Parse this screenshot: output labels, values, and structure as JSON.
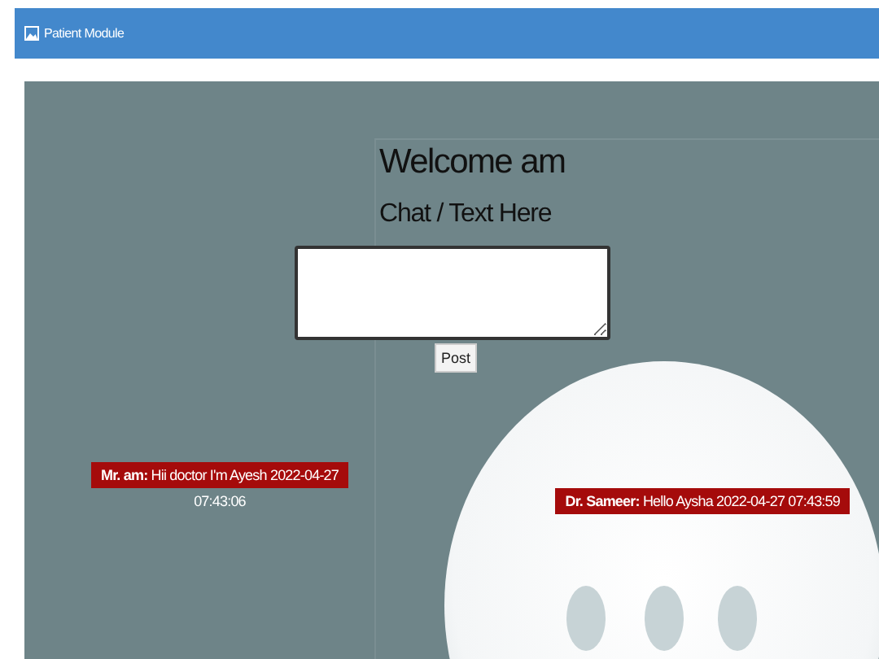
{
  "header": {
    "title": "Patient Module"
  },
  "chat": {
    "welcome": "Welcome am",
    "prompt": "Chat / Text Here",
    "post_button": "Post"
  },
  "messages": [
    {
      "kind": "wrapped",
      "sender": "Mr. am:",
      "text": "Hii doctor I'm Ayesh",
      "date": "2022-04-27",
      "time": "07:43:06"
    },
    {
      "kind": "inline",
      "sender": "Dr. Sameer:",
      "text": "Hello Aysha",
      "date": "2022-04-27",
      "time": "07:43:59"
    }
  ]
}
